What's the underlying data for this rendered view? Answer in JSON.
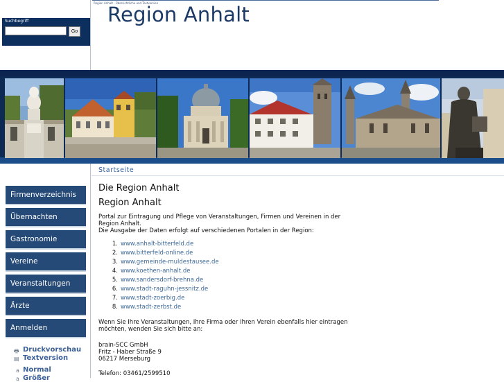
{
  "search": {
    "label": "Suchbegriff",
    "placeholder": "",
    "value": "",
    "go_label": "Go"
  },
  "header": {
    "small_text": "Region Anhalt · Übersichtliche und Textversion",
    "title": "Region Anhalt"
  },
  "banner": {
    "photos": [
      "statue-photo",
      "manor-photo",
      "domed-mausoleum-photo",
      "castle-tower-photo",
      "romanesque-church-photo",
      "luther-statue-photo"
    ]
  },
  "nav": {
    "items": [
      {
        "label": "Firmenverzeichnis"
      },
      {
        "label": "Übernachten"
      },
      {
        "label": "Gastronomie"
      },
      {
        "label": "Vereine"
      },
      {
        "label": "Veranstaltungen"
      },
      {
        "label": "Ärzte"
      },
      {
        "label": "Anmelden"
      }
    ],
    "tools": {
      "print_preview": "Druckvorschau",
      "text_version": "Textversion",
      "normal": "Normal",
      "bigger": "Größer"
    }
  },
  "main": {
    "breadcrumb": "Startseite",
    "heading1": "Die Region Anhalt",
    "heading2": "Region Anhalt",
    "intro_line1": "Portal zur Eintragung und Pflege von Veranstaltungen, Firmen und Vereinen in der",
    "intro_line2": "Region Anhalt.",
    "intro_line3": "Die Ausgabe der Daten erfolgt auf verschiedenen Portalen in der Region:",
    "portals": [
      {
        "num": "1.",
        "url": "www.anhalt-bitterfeld.de"
      },
      {
        "num": "2.",
        "url": "www.bitterfeld-online.de"
      },
      {
        "num": "3.",
        "url": "www.gemeinde-muldestausee.de"
      },
      {
        "num": "4.",
        "url": "www.koethen-anhalt.de"
      },
      {
        "num": "5.",
        "url": "www.sandersdorf-brehna.de"
      },
      {
        "num": "6.",
        "url": "www.stadt-raguhn-jessnitz.de"
      },
      {
        "num": "7.",
        "url": "www.stadt-zoerbig.de"
      },
      {
        "num": "8.",
        "url": "www.stadt-zerbst.de"
      }
    ],
    "contact_line1": "Wenn Sie Ihre Veranstaltungen, Ihre Firma oder Ihren Verein ebenfalls hier eintragen",
    "contact_line2": "möchten, wenden Sie sich bitte an:",
    "company": "brain-SCC GmbH",
    "street": "Fritz - Haber Straße 9",
    "city": "06217 Merseburg",
    "phone": "Telefon: 03461/2599510"
  }
}
